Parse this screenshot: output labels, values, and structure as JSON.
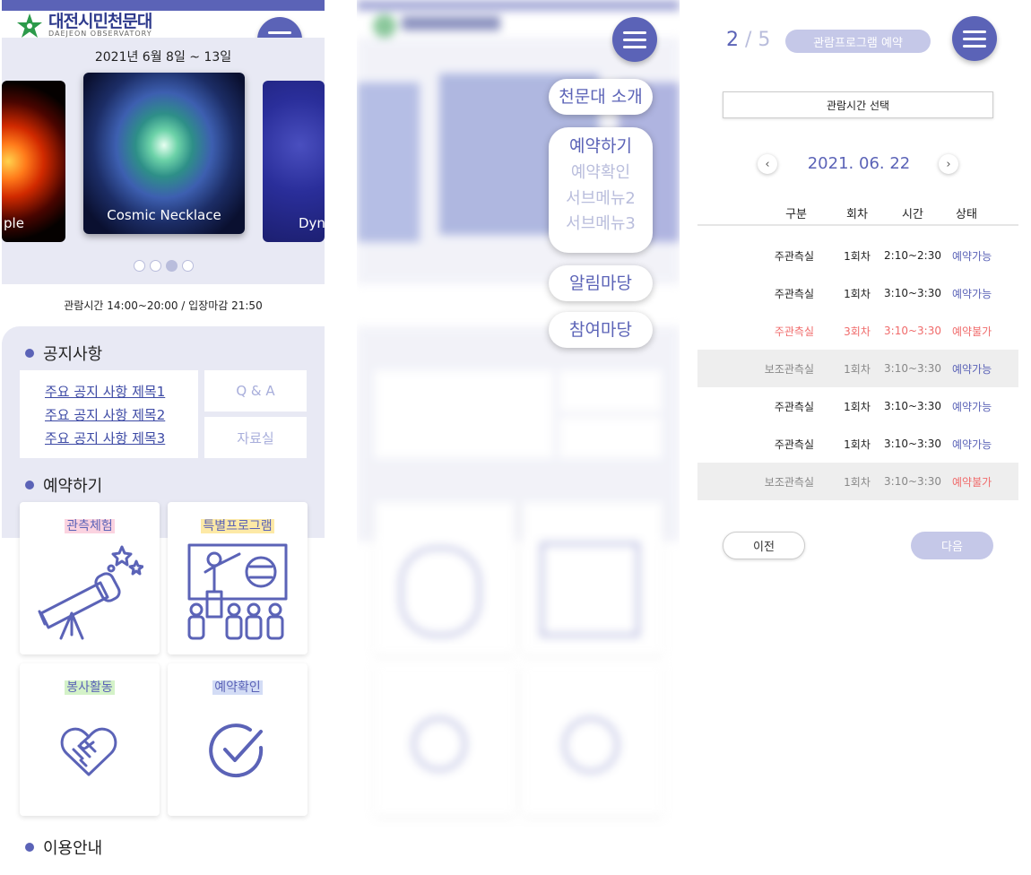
{
  "logo": {
    "title": "대전시민천문대",
    "subtitle": "DAEJEON OBSERVATORY"
  },
  "hero": {
    "date_range": "2021년 6월 8일 ~ 13일",
    "slides": [
      {
        "label": "ple"
      },
      {
        "label": "Cosmic Necklace"
      },
      {
        "label": "Dyn"
      }
    ],
    "dots": 4,
    "active_dot": 3
  },
  "hours_text": "관람시간 14:00~20:00 / 입장마감 21:50",
  "notice": {
    "title": "공지사항",
    "links": [
      "주요 공지 사항 제목1",
      "주요 공지 사항 제목2",
      "주요 공지 사항 제목3"
    ],
    "side_buttons": [
      "Q & A",
      "자료실"
    ]
  },
  "reserve": {
    "title": "예약하기",
    "cards": [
      {
        "label": "관측체험",
        "highlight": "#fbd3e0",
        "icon": "telescope-icon"
      },
      {
        "label": "특별프로그램",
        "highlight": "#fde9a6",
        "icon": "lecture-icon"
      },
      {
        "label": "봉사활동",
        "highlight": "#d4f2c8",
        "icon": "handshake-heart-icon"
      },
      {
        "label": "예약확인",
        "highlight": "#d3dcf5",
        "icon": "check-circle-icon"
      }
    ]
  },
  "guide_title": "이용안내",
  "nav_menu": {
    "items": [
      {
        "label": "천문대 소개"
      },
      {
        "label": "예약하기",
        "subs": [
          "예약확인",
          "서브메뉴2",
          "서브메뉴3"
        ]
      },
      {
        "label": "알림마당"
      },
      {
        "label": "참여마당"
      }
    ]
  },
  "booking": {
    "step_current": "2",
    "step_sep": "/",
    "step_total": "5",
    "program_badge": "관람프로그램 예약",
    "select_label": "관람시간 선택",
    "date": "2021. 06. 22",
    "prev_arrow": "‹",
    "next_arrow": "›",
    "headers": [
      "구분",
      "회차",
      "시간",
      "상태"
    ],
    "rows": [
      {
        "type": "주관측실",
        "round": "1회차",
        "time": "2:10~2:30",
        "status": "예약가능",
        "style": "normal"
      },
      {
        "type": "주관측실",
        "round": "1회차",
        "time": "3:10~3:30",
        "status": "예약가능",
        "style": "normal"
      },
      {
        "type": "주관측실",
        "round": "3회차",
        "time": "3:10~3:30",
        "status": "예약불가",
        "style": "red"
      },
      {
        "type": "보조관측실",
        "round": "1회차",
        "time": "3:10~3:30",
        "status": "예약가능",
        "style": "gray"
      },
      {
        "type": "주관측실",
        "round": "1회차",
        "time": "3:10~3:30",
        "status": "예약가능",
        "style": "normal"
      },
      {
        "type": "주관측실",
        "round": "1회차",
        "time": "3:10~3:30",
        "status": "예약가능",
        "style": "normal"
      },
      {
        "type": "보조관측실",
        "round": "1회차",
        "time": "3:10~3:30",
        "status": "예약불가",
        "style": "gray"
      }
    ],
    "prev_button": "이전",
    "next_button": "다음"
  },
  "colors": {
    "accent": "#5b63b7",
    "light_accent": "#c5c8e8",
    "background": "#e8e9f4",
    "error": "#f06b6b"
  }
}
